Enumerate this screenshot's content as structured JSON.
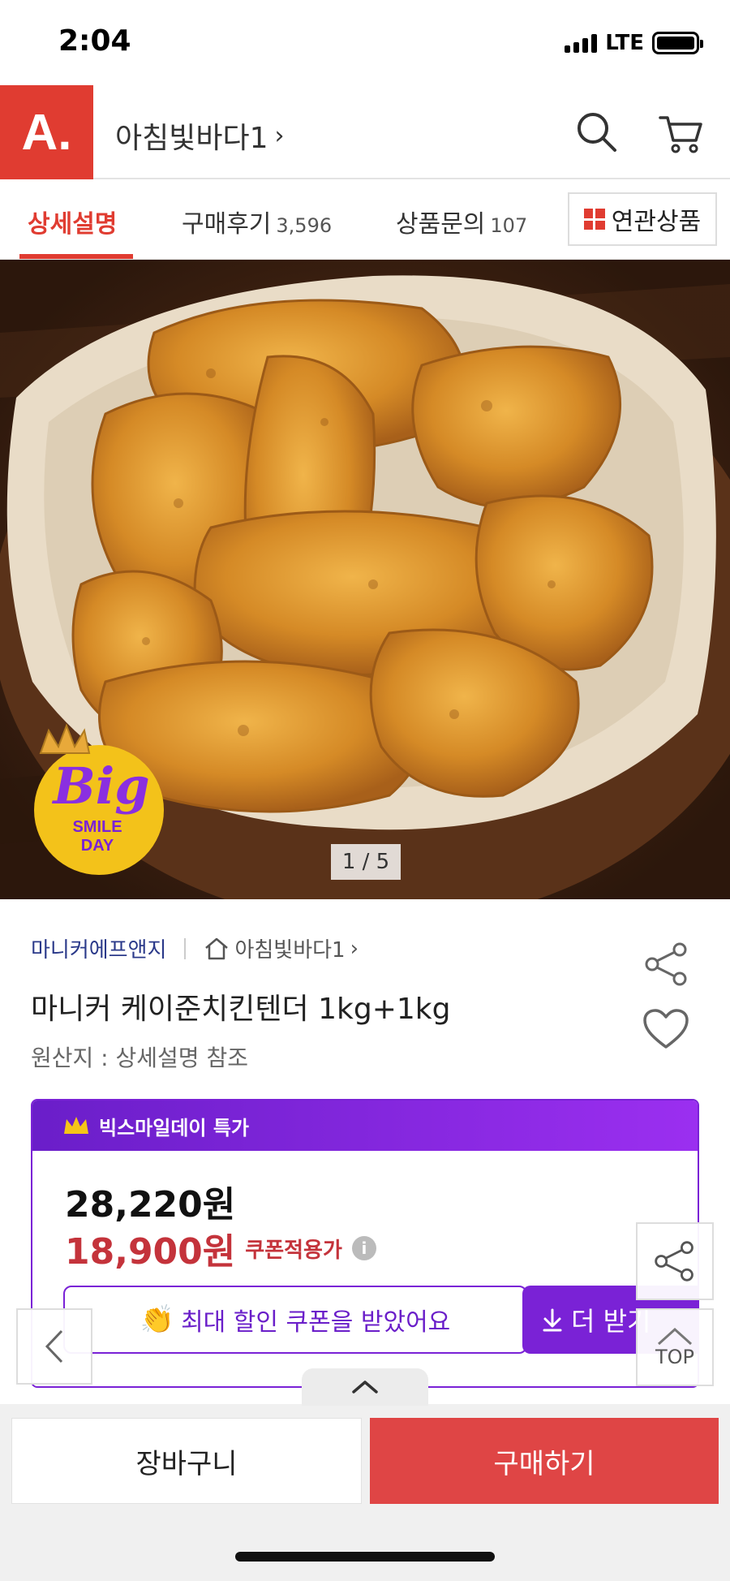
{
  "status_bar": {
    "time": "2:04",
    "network": "LTE"
  },
  "header": {
    "logo": "A.",
    "store_name": "아침빛바다1",
    "chevron": "›"
  },
  "tabs": [
    {
      "label": "상세설명",
      "count": ""
    },
    {
      "label": "구매후기",
      "count": "3,596"
    },
    {
      "label": "상품문의",
      "count": "107"
    }
  ],
  "related_button": {
    "label": "연관상품"
  },
  "hero": {
    "pager": "1 / 5",
    "badge": {
      "top": "Big",
      "line1": "SMILE",
      "line2": "DAY"
    }
  },
  "product": {
    "brand": "마니커에프앤지",
    "store_link": "아침빛바다1",
    "store_chevron": "›",
    "title": "마니커 케이준치킨텐더 1kg+1kg",
    "origin": "원산지 : 상세설명 참조"
  },
  "price_card": {
    "header": "빅스마일데이 특가",
    "original_price": "28,220원",
    "sale_price": "18,900원",
    "sale_label": "쿠폰적용가",
    "info_symbol": "i",
    "coupon_icon": "👏",
    "coupon_text": "최대 할인 쿠폰을 받았어요",
    "more_button": "더 받기"
  },
  "floating": {
    "top_label": "TOP"
  },
  "bottom_bar": {
    "cart_label": "장바구니",
    "buy_label": "구매하기"
  },
  "colors": {
    "brand_red": "#e03c31",
    "purple": "#7a22d6",
    "sale_red": "#c4333b",
    "buy_red": "#df4545"
  }
}
